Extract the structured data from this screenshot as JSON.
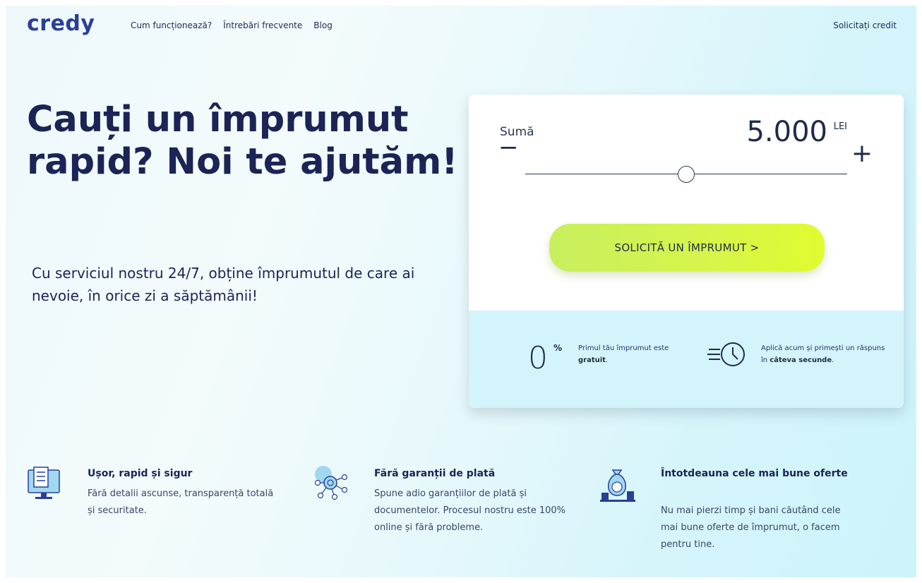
{
  "header": {
    "logo": "credy",
    "nav": [
      "Cum funcționează?",
      "Întrebări frecvente",
      "Blog"
    ],
    "cta": "Solicitați credit"
  },
  "hero": {
    "title": "Cauți un împrumut rapid? Noi te ajutăm!",
    "subtitle": "Cu serviciul nostru 24/7, obține împrumutul de care ai nevoie, în orice zi a săptămânii!"
  },
  "calculator": {
    "amount_label": "Sumă",
    "amount_value": "5.000",
    "currency": "LEI",
    "minus": "−",
    "plus": "+",
    "slider_fraction": 0.5,
    "button_label": "SOLICITĂ UN ÎMPRUMUT  >",
    "info": [
      {
        "big": "0",
        "symbol": "%",
        "text_prefix": "Primul tău împrumut este ",
        "text_bold": "gratuit",
        "text_suffix": "."
      },
      {
        "icon": "fast-clock-icon",
        "text_prefix": "Aplică acum și primești un răspuns în ",
        "text_bold": "câteva secunde",
        "text_suffix": "."
      }
    ]
  },
  "features": [
    {
      "icon": "document-monitor-icon",
      "title": "Ușor, rapid și sigur",
      "description": "Fără detalii ascunse, transparență totală și securitate."
    },
    {
      "icon": "network-coin-icon",
      "title": "Fără garanții de plată",
      "description": "Spune adio garanțiilor de plată și documentelor. Procesul nostru este 100% online și fără probleme."
    },
    {
      "icon": "money-bag-icon",
      "title": "Întotdeauna cele mai bune oferte",
      "description": "Nu mai pierzi timp și bani căutând cele mai bune oferte de împrumut, o facem pentru tine."
    }
  ],
  "colors": {
    "brand": "#2a3f98",
    "text_dark": "#1b2455",
    "button_gradient_start": "#c8ef5e",
    "button_gradient_end": "#e1fb2f",
    "card_bottom_bg": "#d3f4fa"
  }
}
